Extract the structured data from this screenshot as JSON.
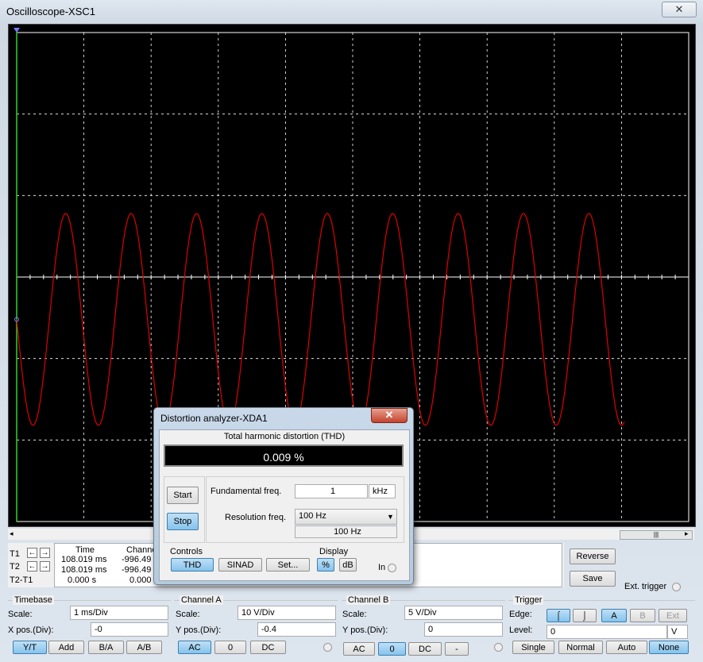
{
  "window": {
    "title": "Oscilloscope-XSC1",
    "close_glyph": "✕"
  },
  "scope": {
    "divisions": {
      "x": 10,
      "y": 6
    },
    "trace_color": "#e00000",
    "grid_color": "#ffffff",
    "background": "#000000",
    "wave": {
      "cycles": 9.3,
      "center_div": 3.0,
      "amplitude_div": 1.3,
      "start_phase": "falling"
    }
  },
  "cursors": {
    "rows": [
      {
        "label": "T1",
        "time": "108.019 ms",
        "channel": "-996.49"
      },
      {
        "label": "T2",
        "time": "108.019 ms",
        "channel": "-996.49"
      },
      {
        "label": "T2-T1",
        "time": "0.000 s",
        "channel": "0.000"
      }
    ],
    "headers": {
      "time": "Time",
      "channel": "Channe"
    },
    "reverse_label": "Reverse",
    "save_label": "Save",
    "ext_trigger_label": "Ext. trigger"
  },
  "timebase": {
    "title": "Timebase",
    "scale_label": "Scale:",
    "scale_value": "1 ms/Div",
    "xpos_label": "X pos.(Div):",
    "xpos_value": "-0",
    "buttons": [
      "Y/T",
      "Add",
      "B/A",
      "A/B"
    ],
    "selected": "Y/T"
  },
  "channel_a": {
    "title": "Channel A",
    "scale_label": "Scale:",
    "scale_value": "10  V/Div",
    "ypos_label": "Y pos.(Div):",
    "ypos_value": "-0.4",
    "buttons": [
      "AC",
      "0",
      "DC"
    ],
    "selected": "AC"
  },
  "channel_b": {
    "title": "Channel B",
    "scale_label": "Scale:",
    "scale_value": "5  V/Div",
    "ypos_label": "Y pos.(Div):",
    "ypos_value": "0",
    "buttons": [
      "AC",
      "0",
      "DC",
      "-"
    ],
    "selected": "0"
  },
  "trigger": {
    "title": "Trigger",
    "edge_label": "Edge:",
    "level_label": "Level:",
    "level_value": "0",
    "level_unit": "V",
    "edge_buttons": [
      "rising",
      "falling"
    ],
    "source_buttons": [
      "A",
      "B",
      "Ext"
    ],
    "source_selected": "A",
    "mode_buttons": [
      "Single",
      "Normal",
      "Auto",
      "None"
    ],
    "mode_selected": "None"
  },
  "distortion": {
    "title": "Distortion analyzer-XDA1",
    "close_glyph": "✕",
    "thd_heading": "Total harmonic distortion (THD)",
    "thd_value": "0.009 %",
    "start_label": "Start",
    "stop_label": "Stop",
    "fund_label": "Fundamental freq.",
    "fund_value": "1",
    "fund_unit": "kHz",
    "res_label": "Resolution freq.",
    "res_value": "100 Hz",
    "res_display": "100 Hz",
    "controls_label": "Controls",
    "controls_buttons": [
      "THD",
      "SINAD",
      "Set..."
    ],
    "display_label": "Display",
    "display_buttons": [
      "%",
      "dB"
    ],
    "in_label": "In"
  }
}
